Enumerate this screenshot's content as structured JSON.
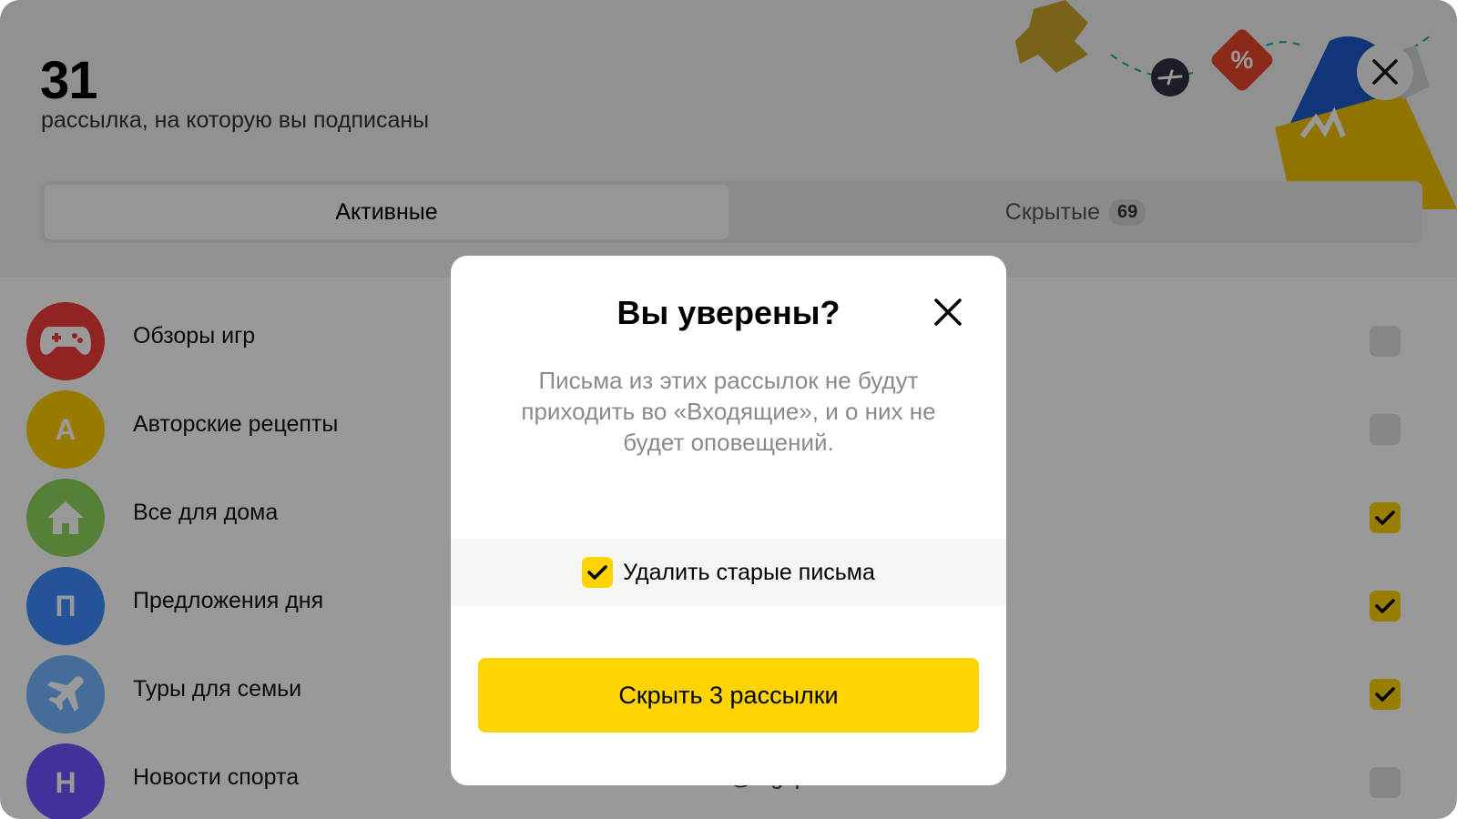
{
  "header": {
    "count": "31",
    "subtitle": "рассылка, на которую вы подписаны"
  },
  "tabs": [
    {
      "label": "Активные",
      "active": true
    },
    {
      "label": "Скрытые",
      "badge": "69",
      "active": false
    }
  ],
  "subscriptions": [
    {
      "name": "Обзоры игр",
      "avatar_letter": "",
      "icon": "gamepad-icon",
      "color": "#f33b3b",
      "email": "",
      "checked": false
    },
    {
      "name": "Авторские рецепты",
      "avatar_letter": "А",
      "icon": "",
      "color": "#ffcc00",
      "email": "",
      "checked": false
    },
    {
      "name": "Все для дома",
      "avatar_letter": "",
      "icon": "home-icon",
      "color": "#8cd55c",
      "email": "",
      "checked": true
    },
    {
      "name": "Предложения дня",
      "avatar_letter": "П",
      "icon": "",
      "color": "#3d8bfd",
      "email": "",
      "checked": true
    },
    {
      "name": "Туры для семьи",
      "avatar_letter": "",
      "icon": "airplane-icon",
      "color": "#72b7ff",
      "email": "",
      "checked": true
    },
    {
      "name": "Новости спорта",
      "avatar_letter": "Н",
      "icon": "",
      "color": "#6a55ff",
      "email": "news@bigsport.ru",
      "checked": false
    }
  ],
  "modal": {
    "title": "Вы уверены?",
    "message": "Письма из этих рассылок не будут приходить во «Входящие», и о них не будет оповещений.",
    "option_label": "Удалить старые письма",
    "option_checked": true,
    "primary_button": "Скрыть 3 рассылки"
  },
  "colors": {
    "accent": "#fdd300",
    "overlay": "rgba(0,0,0,0.40)"
  }
}
